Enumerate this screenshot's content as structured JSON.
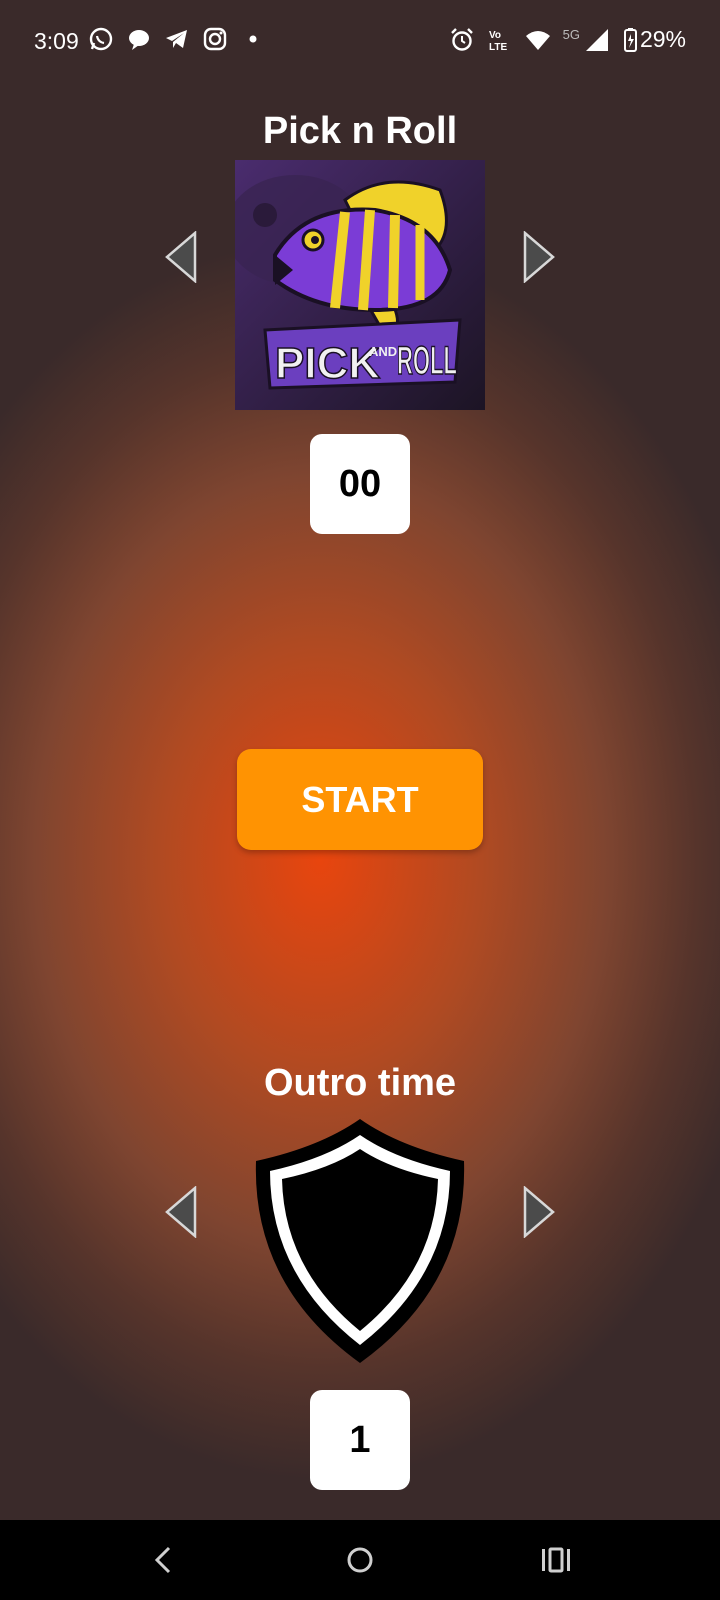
{
  "status_bar": {
    "time": "3:09",
    "battery": "29%",
    "network": "5G",
    "left_icons": [
      "whatsapp-icon",
      "message-icon",
      "telegram-icon",
      "instagram-icon",
      "dot-icon"
    ],
    "right_icons": [
      "alarm-icon",
      "volte-icon",
      "wifi-icon",
      "signal-icon",
      "battery-icon"
    ]
  },
  "pick_section": {
    "title": "Pick n Roll",
    "value": "00",
    "logo_name": "pick-and-roll-logo",
    "logo_text_line1": "PICK",
    "logo_text_line2": "AND",
    "logo_text_line3": "ROLL"
  },
  "start_button": {
    "label": "START"
  },
  "outro_section": {
    "title": "Outro time",
    "value": "1"
  },
  "nav_bar": {
    "items": [
      "back-icon",
      "home-icon",
      "recents-icon"
    ]
  },
  "colors": {
    "accent": "#ff9302",
    "background_center": "#e8450e",
    "background_edge": "#3a2a2a",
    "logo_purple": "#7b3cd6",
    "logo_yellow": "#f0d22a"
  }
}
